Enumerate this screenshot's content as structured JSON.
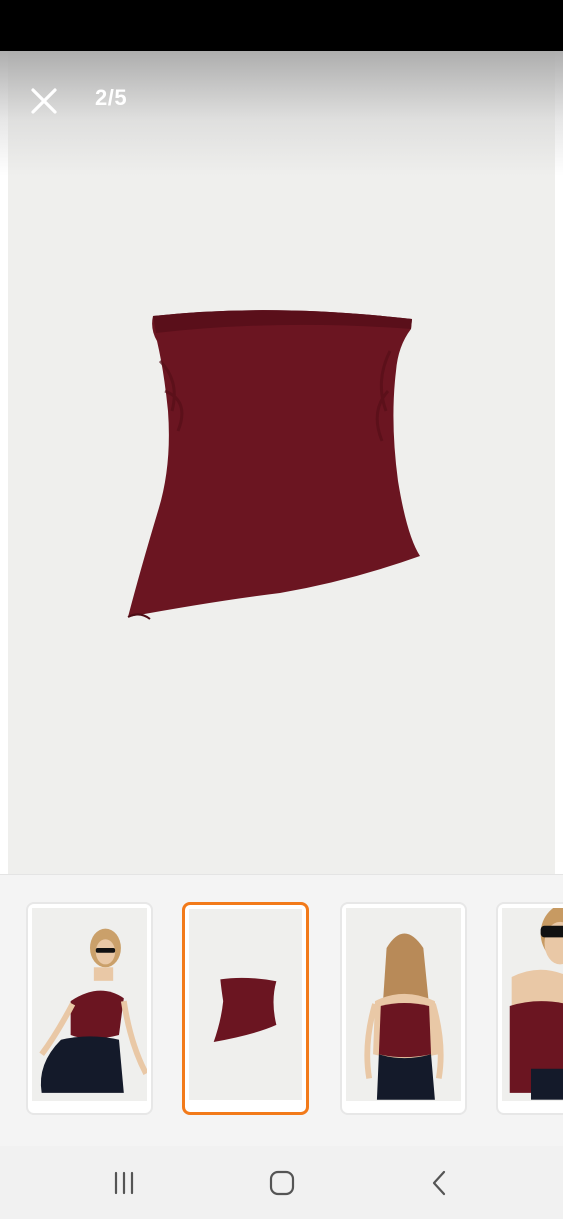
{
  "viewer": {
    "counter": "2/5",
    "close_icon": "close-icon",
    "product_color": "#6a1420"
  },
  "thumbnails": [
    {
      "label": "model-front",
      "selected": false
    },
    {
      "label": "product-flat",
      "selected": true
    },
    {
      "label": "model-back",
      "selected": false
    },
    {
      "label": "model-closeup",
      "selected": false
    }
  ],
  "accent_color": "#f27a1a",
  "nav": {
    "recent_icon": "recent-apps-icon",
    "home_icon": "home-icon",
    "back_icon": "back-icon"
  }
}
